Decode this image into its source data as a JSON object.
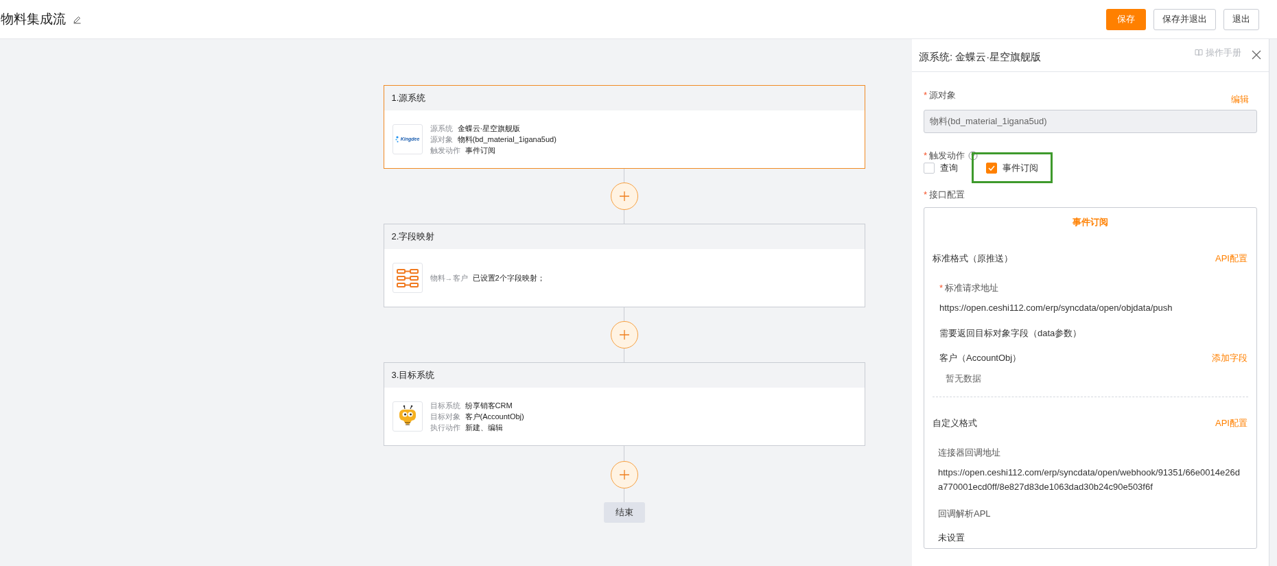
{
  "header": {
    "title": "物料集成流",
    "buttons": [
      {
        "label": "保存",
        "kind": "primary"
      },
      {
        "label": "保存并退出",
        "kind": "default"
      },
      {
        "label": "退出",
        "kind": "default"
      }
    ]
  },
  "flow": {
    "nodes": [
      {
        "title": "1.源系统",
        "selected": true,
        "kind": "kingdee",
        "logo_text": "Kingdee",
        "fields": [
          {
            "label": "源系统",
            "value": "金蝶云·星空旗舰版"
          },
          {
            "label": "源对象",
            "value": "物料(bd_material_1igana5ud)"
          },
          {
            "label": "触发动作",
            "value": "事件订阅"
          }
        ]
      },
      {
        "title": "2.字段映射",
        "selected": false,
        "kind": "mapping",
        "fields": [
          {
            "label": "物料→客户",
            "value": "已设置2个字段映射；"
          }
        ]
      },
      {
        "title": "3.目标系统",
        "selected": false,
        "kind": "bee",
        "fields": [
          {
            "label": "目标系统",
            "value": "纷享销客CRM"
          },
          {
            "label": "目标对象",
            "value": "客户(AccountObj)"
          },
          {
            "label": "执行动作",
            "value": "新建、编辑"
          }
        ]
      }
    ],
    "end_label": "结束"
  },
  "panel": {
    "title": "源系统: 金蝶云·星空旗舰版",
    "manual": "操作手册",
    "source_object": {
      "mark": "*",
      "label": "源对象",
      "edit": "编辑",
      "value": "物料(bd_material_1igana5ud)"
    },
    "trigger": {
      "mark": "*",
      "label": "触发动作",
      "options": [
        {
          "label": "查询",
          "checked": false,
          "highlighted": false
        },
        {
          "label": "事件订阅",
          "checked": true,
          "highlighted": true
        }
      ]
    },
    "interface": {
      "mark": "*",
      "label": "接口配置",
      "tab": "事件订阅",
      "standard": {
        "title": "标准格式（原推送）",
        "link": "API配置",
        "url_mark": "*",
        "url_label": "标准请求地址",
        "url": "https://open.ceshi112.com/erp/syncdata/open/objdata/push",
        "fields_title": "需要返回目标对象字段（data参数）",
        "object": "客户（AccountObj）",
        "add": "添加字段",
        "empty": "暂无数据"
      },
      "custom": {
        "title": "自定义格式",
        "link": "API配置",
        "callback_label": "连接器回调地址",
        "callback_url": "https://open.ceshi112.com/erp/syncdata/open/webhook/91351/66e0014e26da770001ecd0ff/8e827d83de1063dad30b24c90e503f6f",
        "apl_label": "回调解析APL",
        "apl_value": "未设置"
      }
    }
  }
}
